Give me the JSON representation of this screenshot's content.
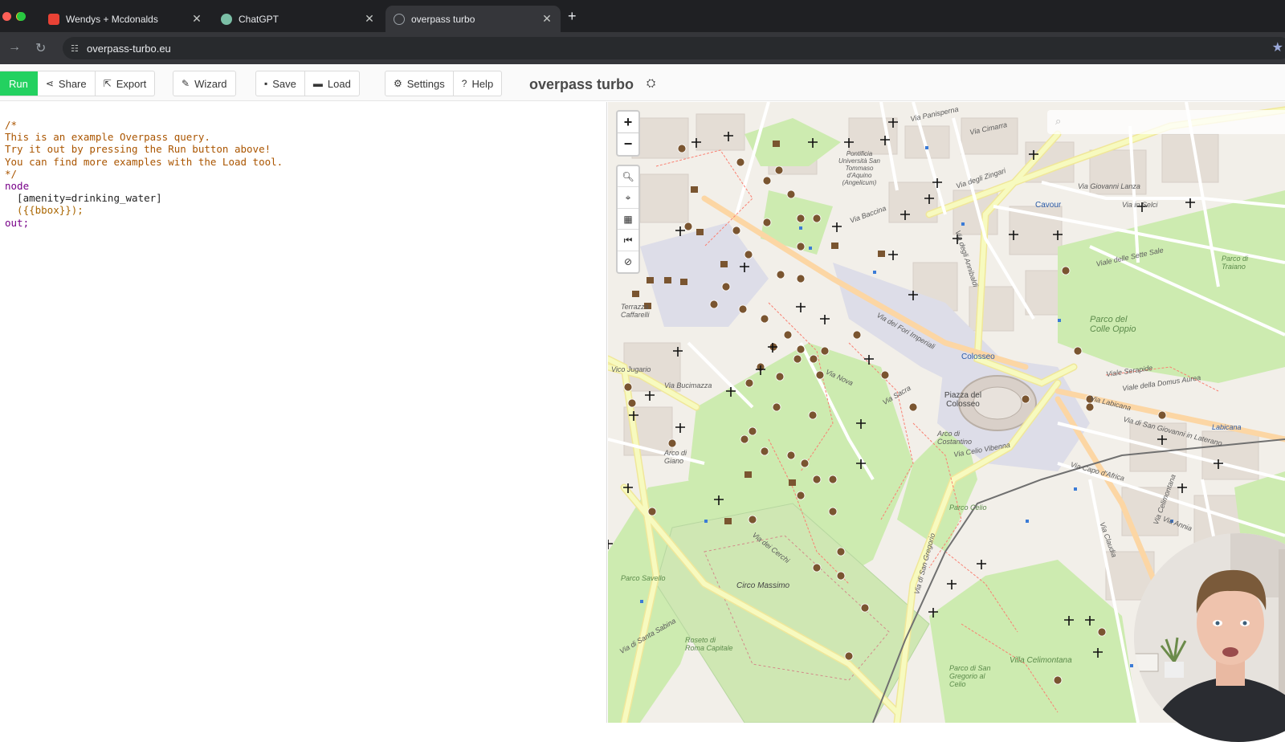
{
  "browser": {
    "tabs": [
      {
        "label": "Wendys + Mcdonalds",
        "favicon_color": "#e94235",
        "active": false
      },
      {
        "label": "ChatGPT",
        "favicon_color": "#7bbfa6",
        "active": false
      },
      {
        "label": "overpass turbo",
        "favicon_color": "#9aa0a6",
        "active": true
      }
    ],
    "new_tab": "+",
    "url": "overpass-turbo.eu"
  },
  "toolbar": {
    "run": "Run",
    "share": "Share",
    "export": "Export",
    "wizard": "Wizard",
    "save": "Save",
    "load": "Load",
    "settings": "Settings",
    "help": "Help",
    "title": "overpass turbo"
  },
  "editor": {
    "lines": [
      "/*",
      "This is an example Overpass query.",
      "Try it out by pressing the Run button above!",
      "You can find more examples with the Load tool.",
      "*/",
      "node",
      "  [amenity=drinking_water]",
      "  ({{bbox}});",
      "out;"
    ]
  },
  "map": {
    "zoom_in": "+",
    "zoom_out": "−",
    "labels": {
      "via_panisperna": "Via Panisperna",
      "via_cimarra": "Via Cimarra",
      "pontificia": "Pontificia Università San Tommaso d'Aquino (Angelicum)",
      "via_degli_zingari": "Via degli Zingari",
      "via_giovanni_lanza": "Via Giovanni Lanza",
      "cavour": "Cavour",
      "via_in_selci": "Via in Selci",
      "via_baccina": "Via Baccina",
      "via_degli_annibaldi": "Via degli Annibaldi",
      "viale_delle_sette_sale": "Viale delle Sette Sale",
      "parco_di_traiano": "Parco di Traiano",
      "terrazza_caffarelli": "Terrazza Caffarelli",
      "via_dei_fori_imperiali": "Via dei Fori Imperiali",
      "parco_del_colle_oppio": "Parco del Colle Oppio",
      "colosseo": "Colosseo",
      "piazza_del_colosseo": "Piazza del Colosseo",
      "via_labicana": "Via Labicana",
      "arco_di_costantino": "Arco di Costantino",
      "via_celio_vibenna": "Via Celio Vibenna",
      "via_bucimazza": "Via Bucimazza",
      "vico_jugario": "Vico Jugario",
      "arco_di_giano": "Arco di Giano",
      "via_dei_cerchi": "Via dei Cerchi",
      "circo_massimo": "Circo Massimo",
      "via_di_san_gregorio": "Via di San Gregorio",
      "parco_celio": "Parco Celio",
      "parco_savello": "Parco Savello",
      "roseto_di_roma": "Roseto di Roma Capitale",
      "via_di_santa_sabina": "Via di Santa Sabina",
      "villa_celimontana": "Villa Celimontana",
      "san_gregorio": "Parco di San Gregorio al Celio",
      "via_capo_d_africa": "Via Capo d'Africa",
      "via_annia": "Via Annia",
      "via_claudia": "Via Claudia",
      "labicana": "Labicana",
      "via_della_domus_aurea": "Viale della Domus Aurea",
      "via_san_giovanni": "Via di San Giovanni in Laterano",
      "via_celimontana": "Via Celimontana",
      "via_della_sacra": "Via Sacra",
      "via_nova": "Via Nova",
      "via_dei_serapide": "Viale Serapide"
    },
    "colors": {
      "land": "#f2efe9",
      "park": "#cdebb0",
      "pedestrian": "#dddde8",
      "major_road": "#f7fabf",
      "secondary_road": "#fcd6a4",
      "building": "#d9d0c9",
      "footway": "#fa8072",
      "rail": "#707070"
    }
  }
}
